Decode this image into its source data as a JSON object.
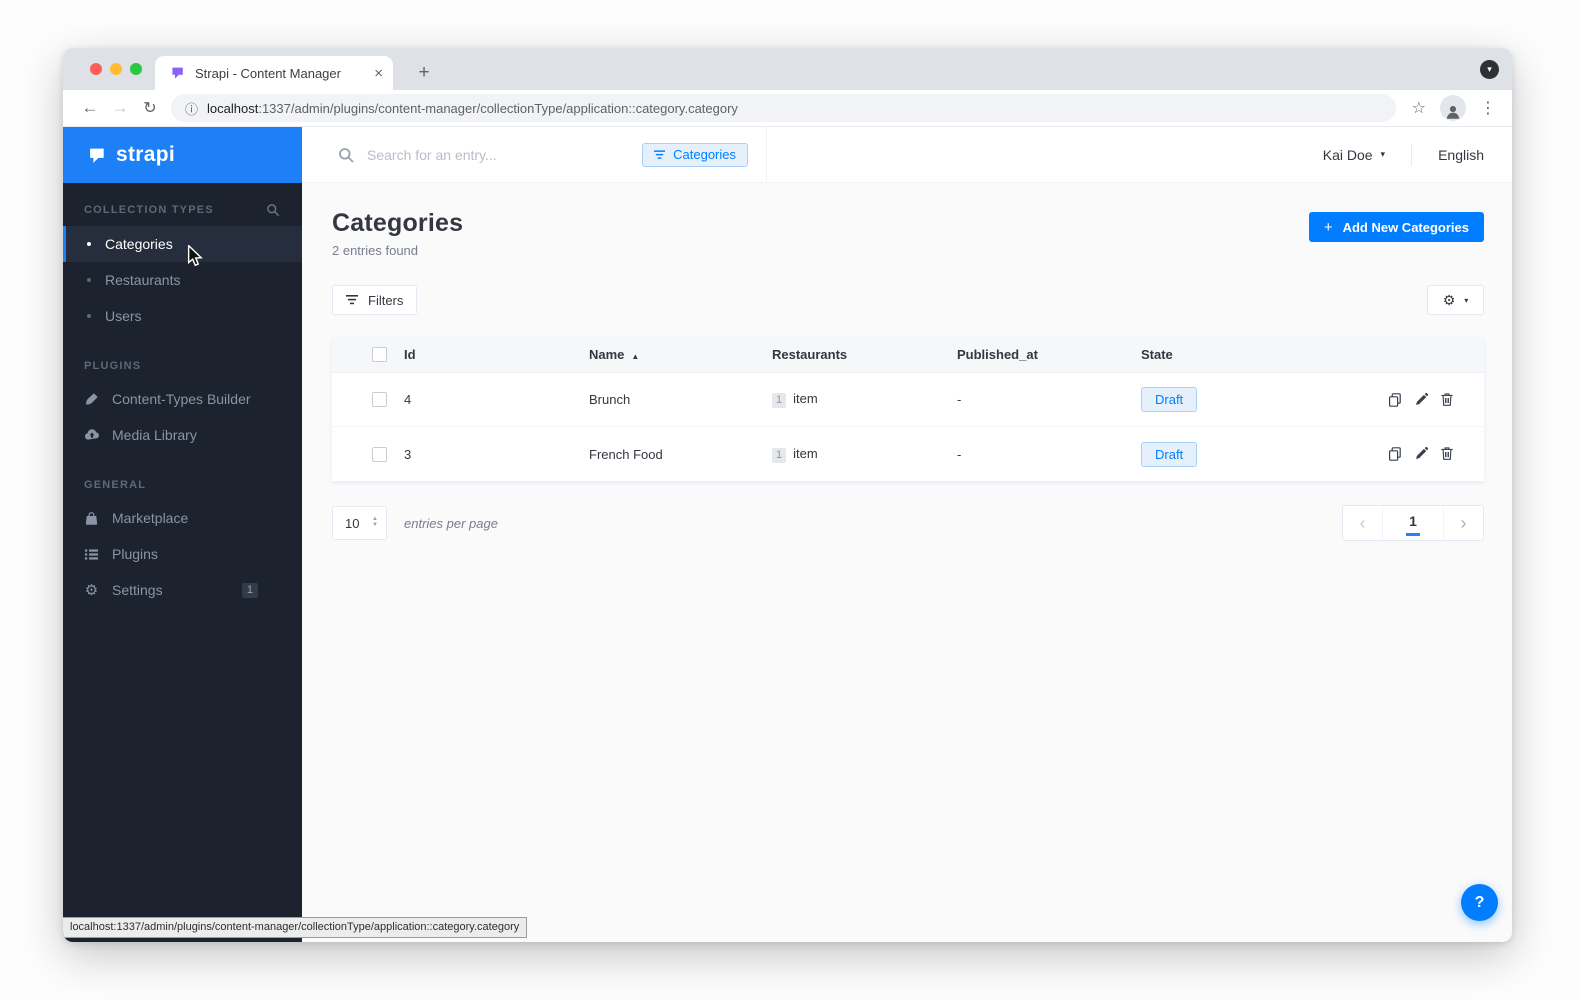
{
  "browser": {
    "tab_title": "Strapi - Content Manager",
    "url_host": "localhost",
    "url_path": ":1337/admin/plugins/content-manager/collectionType/application::category.category"
  },
  "icons": {
    "close": "×",
    "new_tab": "+",
    "tab_search_caret": "▾",
    "back": "←",
    "forward": "→",
    "reload": "↻",
    "info": "ⓘ",
    "star": "☆",
    "menu_dots": "⋮",
    "caret_down": "▾",
    "plus": "+",
    "gear": "⚙",
    "sort_asc": "▲",
    "stepper_up": "▲",
    "stepper_down": "▼",
    "chevron_left": "‹",
    "chevron_right": "›",
    "help": "?"
  },
  "sidebar": {
    "logo_text": "strapi",
    "sections": [
      {
        "label": "COLLECTION TYPES",
        "items": [
          {
            "label": "Categories"
          },
          {
            "label": "Restaurants"
          },
          {
            "label": "Users"
          }
        ]
      },
      {
        "label": "PLUGINS",
        "items": [
          {
            "label": "Content-Types Builder"
          },
          {
            "label": "Media Library"
          }
        ]
      },
      {
        "label": "GENERAL",
        "items": [
          {
            "label": "Marketplace"
          },
          {
            "label": "Plugins"
          },
          {
            "label": "Settings",
            "badge": "1"
          }
        ]
      }
    ],
    "status_url": "localhost:1337/admin/plugins/content-manager/collectionType/application::category.category"
  },
  "topbar": {
    "search_placeholder": "Search for an entry...",
    "filter_chip_label": "Categories",
    "user_name": "Kai Doe",
    "language_label": "English"
  },
  "page": {
    "title": "Categories",
    "entries_found": "2 entries found",
    "add_button_label": "Add New Categories",
    "filters_label": "Filters"
  },
  "table": {
    "columns": {
      "id": "Id",
      "name": "Name",
      "restaurants": "Restaurants",
      "published_at": "Published_at",
      "state": "State"
    },
    "sorted_column": "Name",
    "sort_direction": "asc",
    "rows": [
      {
        "id": "4",
        "name": "Brunch",
        "restaurants_count": "1",
        "restaurants_unit": "item",
        "published_at": "-",
        "state": "Draft"
      },
      {
        "id": "3",
        "name": "French Food",
        "restaurants_count": "1",
        "restaurants_unit": "item",
        "published_at": "-",
        "state": "Draft"
      }
    ]
  },
  "pagination": {
    "per_page": "10",
    "per_page_label": "entries per page",
    "current_page": "1"
  },
  "colors": {
    "primary": "#007eff",
    "sidebar_bg": "#1c222e",
    "sidebar_header_blue": "#1d80f6"
  }
}
